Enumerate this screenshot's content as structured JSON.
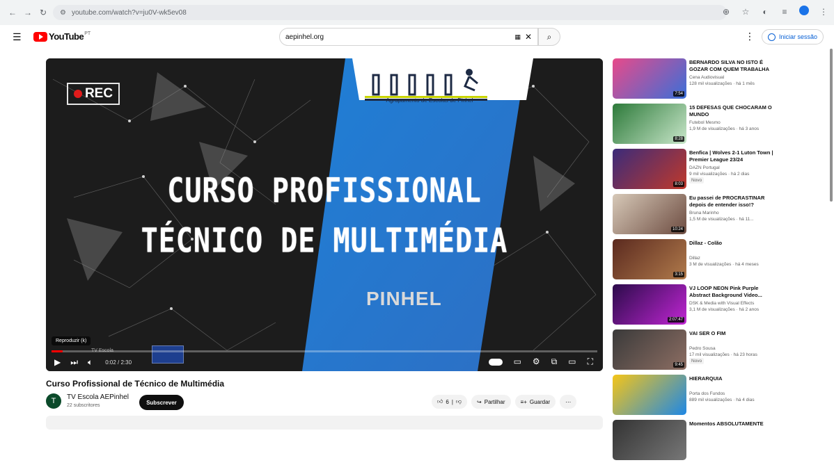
{
  "browser": {
    "url": "youtube.com/watch?v=ju0V-wk5ev08",
    "colors": {
      "bar": "#f1f3f4",
      "url_bg": "#e8eaed"
    }
  },
  "header": {
    "logo_text": "YouTube",
    "logo_region": "PT",
    "search_value": "aepinhel.org",
    "signin_label": "Iniciar sessão"
  },
  "player": {
    "rec_label": "REC",
    "school_name": "Agrupamento de Escolas de Pinhel",
    "title_line1": "CURSO PROFISSIONAL",
    "title_line2": "TÉCNICO DE MULTIMÉDIA",
    "town": "PINHEL",
    "playing_label": "Reproduzir (k)",
    "endcard_text": "TV Escola",
    "time": "0:02 / 2:30",
    "progress": 0.02,
    "accent": "#ff0000"
  },
  "video": {
    "title": "Curso Profissional de Técnico de Multimédia",
    "channel_initial": "T",
    "channel": "TV Escola AEPinhel",
    "subscribers": "22 subscritores",
    "subscribe_label": "Subscrever",
    "likes": "6",
    "share_label": "Partilhar",
    "save_label": "Guardar"
  },
  "sidebar": {
    "items": [
      {
        "title": "BERNARDO SILVA NO ISTO É GOZAR COM QUEM TRABALHA",
        "channel": "Cena Audiovisual",
        "meta": "128 mil visualizações · há 1 mês",
        "duration": "7:54",
        "colors": [
          "#e84a8a",
          "#3a6fd8"
        ]
      },
      {
        "title": "15 DEFESAS QUE CHOCARAM O MUNDO",
        "channel": "Futebol Mesmo",
        "meta": "1,9 M de visualizações · há 3 anos",
        "duration": "8:28",
        "colors": [
          "#2d7a3a",
          "#c8e6c9"
        ]
      },
      {
        "title": "Benfica | Wolves 2-1 Luton Town | Premier League 23/24",
        "channel": "DAZN Portugal",
        "meta": "9 mil visualizações · há 2 dias",
        "duration": "8:03",
        "badge": "Novo",
        "colors": [
          "#3b2b7a",
          "#c0392b"
        ]
      },
      {
        "title": "Eu passei de PROCRASTINAR depois de entender isso!?",
        "channel": "Bruna Marinho",
        "meta": "1,5 M de visualizações · há 11...",
        "duration": "10:24",
        "colors": [
          "#d7c9b8",
          "#6d4c41"
        ]
      },
      {
        "title": "Dillaz - Colão",
        "channel": "Dillaz",
        "meta": "3 M de visualizações · há 4 meses",
        "duration": "3:15",
        "colors": [
          "#5b2a1f",
          "#b07a4b"
        ]
      },
      {
        "title": "VJ LOOP NEON Pink Purple Abstract Background Video...",
        "channel": "DSK & Media with Visual Effects",
        "meta": "3,1 M de visualizações · há 2 anos",
        "duration": "2:07:47",
        "colors": [
          "#2b0b4a",
          "#c026d3"
        ]
      },
      {
        "title": "VAI SER O FIM",
        "channel": "Pedro Sousa",
        "meta": "17 mil visualizações · há 23 horas",
        "duration": "9:45",
        "badge": "Novo",
        "colors": [
          "#3a3a3a",
          "#8d6e63"
        ]
      },
      {
        "title": "HIERARQUIA",
        "channel": "Porta dos Fundos",
        "meta": "889 mil visualizações · há 4 dias",
        "duration": "",
        "colors": [
          "#f5c518",
          "#1e88e5"
        ]
      },
      {
        "title": "Momentos ABSOLUTAMENTE",
        "channel": "",
        "meta": "",
        "duration": "",
        "colors": [
          "#333333",
          "#777777"
        ]
      }
    ]
  }
}
